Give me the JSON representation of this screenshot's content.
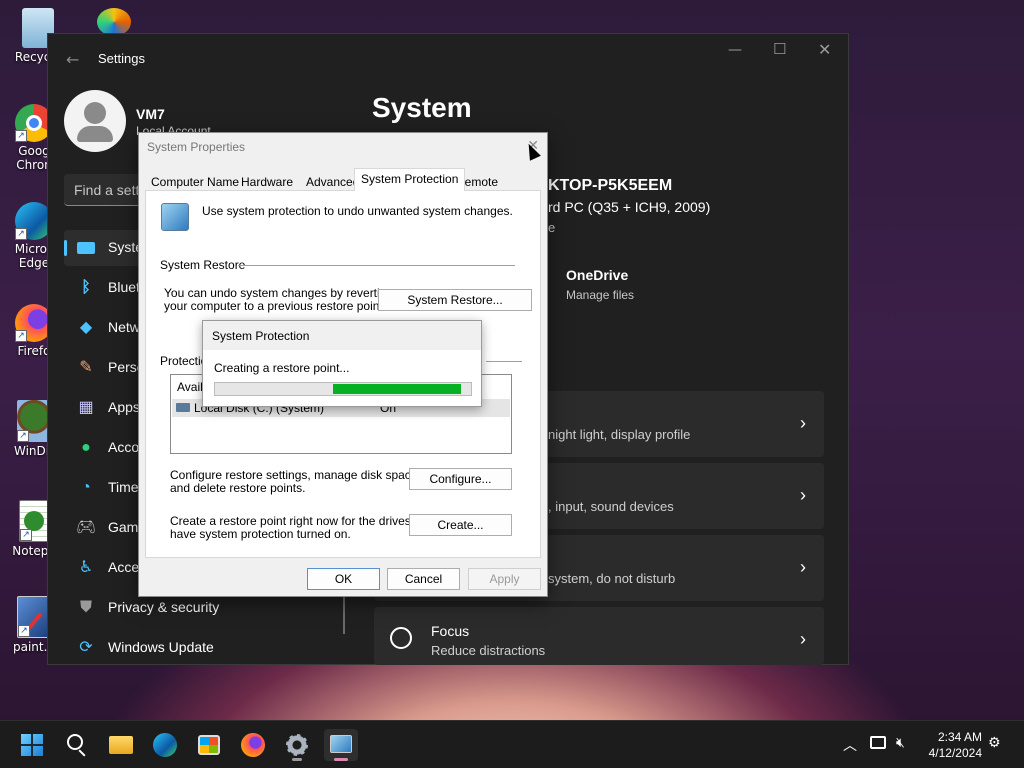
{
  "desktop": {
    "icons": [
      {
        "label": "Recycle",
        "icon": "recycle-bin-icon"
      },
      {
        "label": "",
        "icon": "app-icon"
      },
      {
        "label": "Goog",
        "label2": "Chron",
        "icon": "chrome-icon"
      },
      {
        "label": "Micros",
        "label2": "Edge",
        "icon": "edge-icon"
      },
      {
        "label": "Firefo",
        "icon": "firefox-icon"
      },
      {
        "label": "WinDir",
        "icon": "windirstat-icon"
      },
      {
        "label": "Notepa",
        "icon": "notepad-icon"
      },
      {
        "label": "paint.n",
        "icon": "paint-icon"
      }
    ]
  },
  "settings": {
    "window_title": "Settings",
    "user": {
      "name": "VM7",
      "account": "Local Account"
    },
    "search_placeholder": "Find a sett",
    "nav": [
      {
        "label": "Syste",
        "icon": "system-icon",
        "selected": true
      },
      {
        "label": "Bluet",
        "icon": "bluetooth-icon"
      },
      {
        "label": "Netw",
        "icon": "network-icon"
      },
      {
        "label": "Perso",
        "icon": "personalization-icon"
      },
      {
        "label": "Apps",
        "icon": "apps-icon"
      },
      {
        "label": "Acco",
        "icon": "accounts-icon"
      },
      {
        "label": "Time",
        "icon": "time-icon"
      },
      {
        "label": "Gam",
        "icon": "gaming-icon"
      },
      {
        "label": "Acce",
        "icon": "accessibility-icon"
      },
      {
        "label": "Privacy & security",
        "icon": "privacy-icon"
      },
      {
        "label": "Windows Update",
        "icon": "windows-update-icon"
      }
    ],
    "page_title": "System",
    "pc_name": "KTOP-P5K5EEM",
    "pc_model": "rd PC (Q35 + ICH9, 2009)",
    "rename": "e",
    "onedrive": {
      "title": "OneDrive",
      "subtitle": "Manage files"
    },
    "cards": [
      {
        "title": "",
        "subtitle": "night light, display profile"
      },
      {
        "title": "",
        "subtitle": ", input, sound devices"
      },
      {
        "title": "",
        "subtitle": "system, do not disturb"
      },
      {
        "title": "Focus",
        "subtitle": "Reduce distractions"
      }
    ]
  },
  "system_properties": {
    "title": "System Properties",
    "tabs": [
      "Computer Name",
      "Hardware",
      "Advanced",
      "System Protection",
      "Remote"
    ],
    "active_tab": "System Protection",
    "intro": "Use system protection to undo unwanted system changes.",
    "restore_section": "System Restore",
    "restore_text_1": "You can undo system changes by reverting",
    "restore_text_2": "your computer to a previous restore point.",
    "restore_button": "System Restore...",
    "protection_section": "Protection",
    "list_header": "Availa",
    "drive": {
      "name": "Local Disk (C:) (System)",
      "status": "On"
    },
    "configure_text_1": "Configure restore settings, manage disk space,",
    "configure_text_2": "and delete restore points.",
    "configure_button": "Configure...",
    "create_text_1": "Create a restore point right now for the drives that",
    "create_text_2": "have system protection turned on.",
    "create_button": "Create...",
    "ok": "OK",
    "cancel": "Cancel",
    "apply": "Apply"
  },
  "progress_dialog": {
    "title": "System Protection",
    "message": "Creating a restore point...",
    "progress_segment_start": 0.46,
    "progress_segment_end": 0.96,
    "color": "#06b025"
  },
  "taskbar": {
    "apps": [
      "start-icon",
      "search-icon",
      "file-explorer-icon",
      "edge-icon",
      "store-icon",
      "firefox-icon",
      "settings-icon",
      "system-properties-icon"
    ],
    "time": "2:34 AM",
    "date": "4/12/2024"
  }
}
